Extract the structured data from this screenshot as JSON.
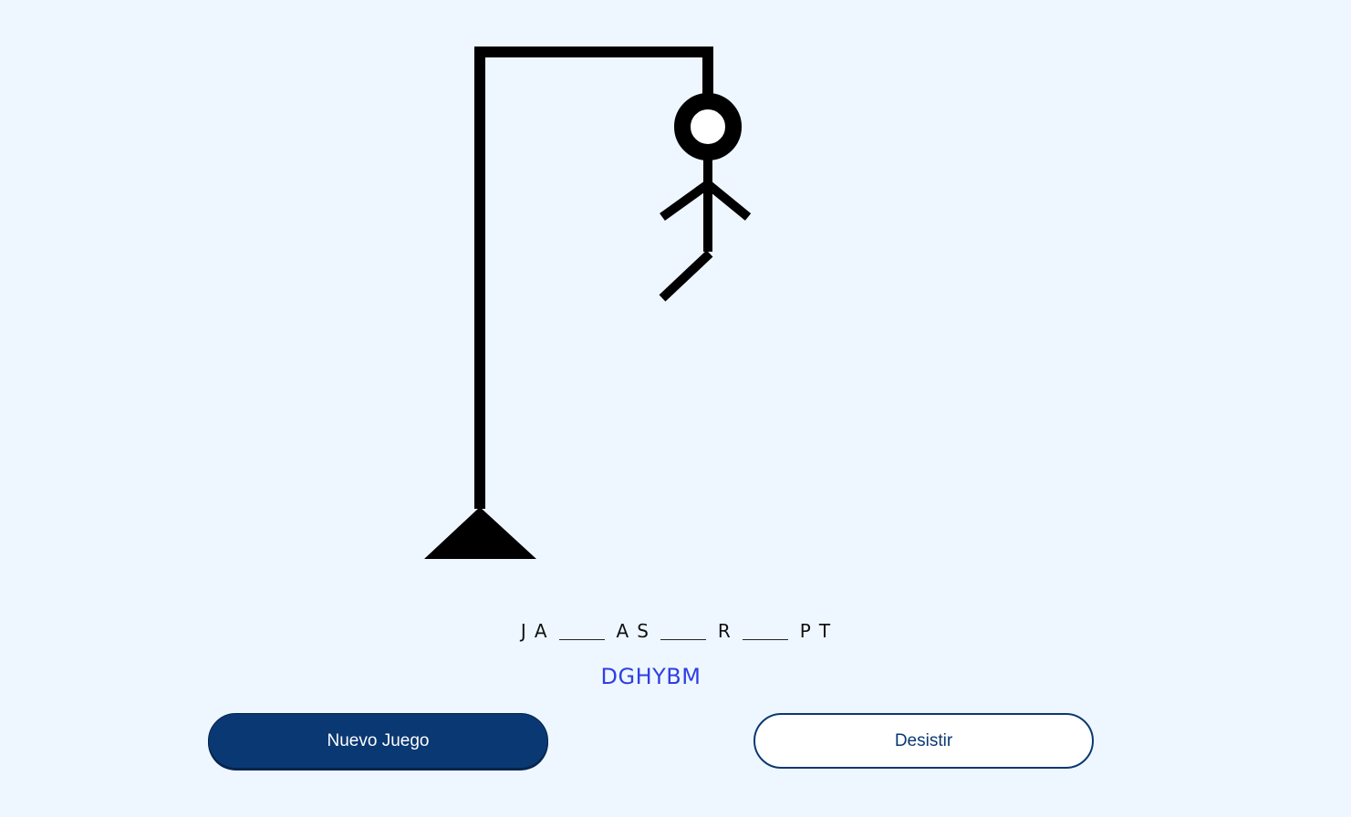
{
  "game": {
    "title": "",
    "word_slots": [
      {
        "letter": "J",
        "revealed": true
      },
      {
        "letter": "A",
        "revealed": true
      },
      {
        "letter": "",
        "revealed": false
      },
      {
        "letter": "A",
        "revealed": true
      },
      {
        "letter": "S",
        "revealed": true
      },
      {
        "letter": "",
        "revealed": false
      },
      {
        "letter": "R",
        "revealed": true
      },
      {
        "letter": "",
        "revealed": false
      },
      {
        "letter": "P",
        "revealed": true
      },
      {
        "letter": "T",
        "revealed": true
      }
    ],
    "wrong_letters": "DGHYBM",
    "errors_count": 6
  },
  "buttons": {
    "new_game_label": "Nuevo Juego",
    "give_up_label": "Desistir"
  },
  "colors": {
    "background": "#eef7ff",
    "primary": "#0a3872",
    "wrong_letters": "#2f3fe3",
    "drawing": "#000000"
  }
}
